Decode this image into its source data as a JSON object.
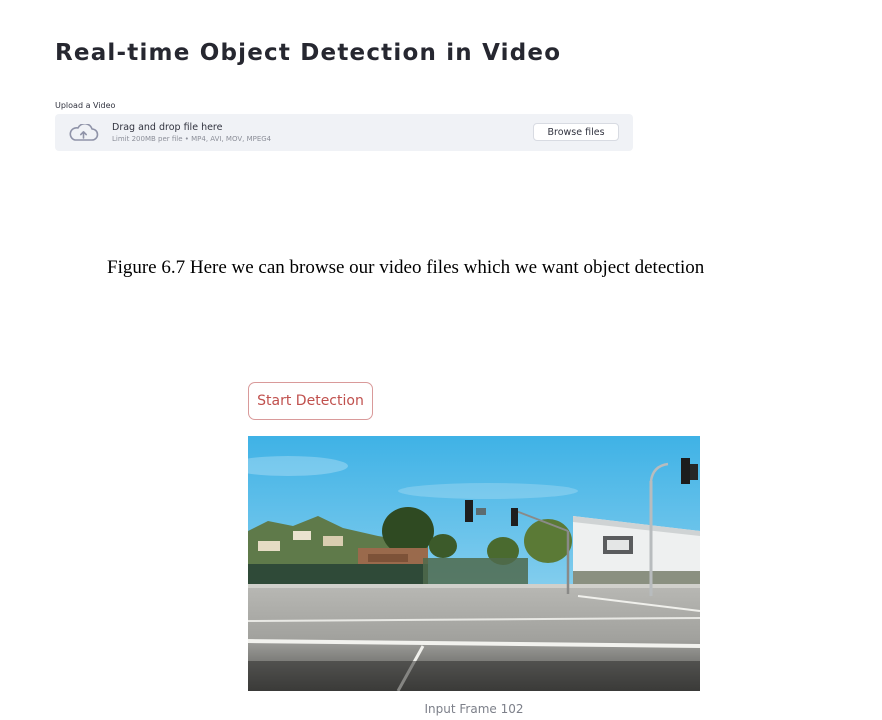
{
  "app": {
    "title": "Real-time Object Detection in Video"
  },
  "uploader": {
    "label": "Upload a Video",
    "icon": "cloud-upload-icon",
    "drop_text": "Drag and drop file here",
    "limit_text": "Limit 200MB per file • MP4, AVI, MOV, MPEG4",
    "browse_label": "Browse files"
  },
  "figure": {
    "caption": "Figure 6.7 Here we can browse our video files which we want object detection"
  },
  "detection": {
    "start_label": "Start Detection",
    "frame_caption": "Input Frame 102"
  },
  "colors": {
    "accent": "#c0504d",
    "dropzone_bg": "#f0f2f6",
    "title": "#262730"
  }
}
